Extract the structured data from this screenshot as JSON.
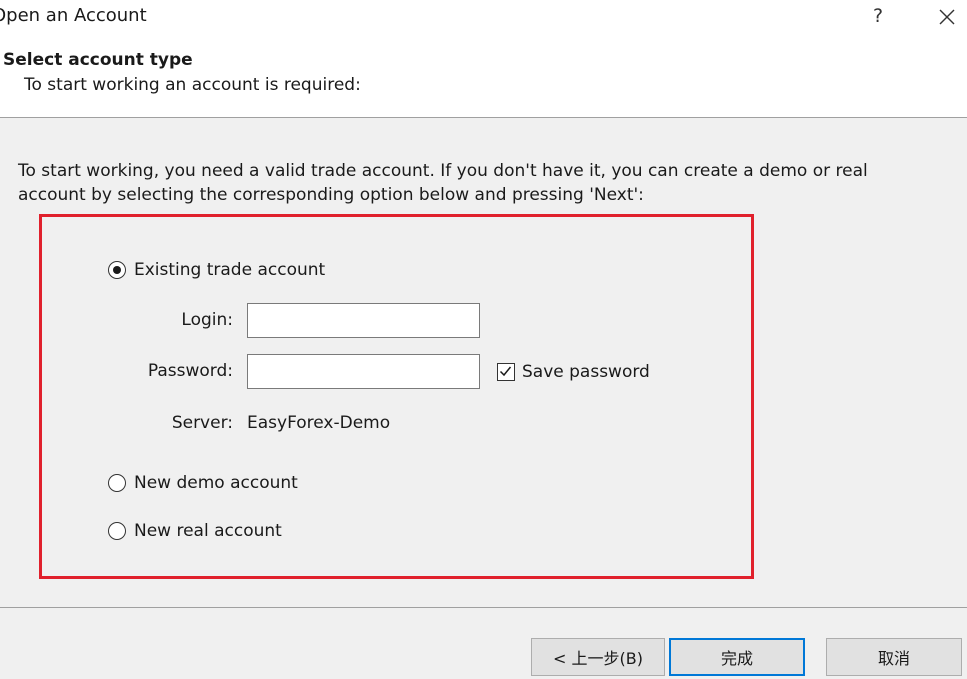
{
  "window": {
    "title": "Open an Account",
    "help_label": "?"
  },
  "header": {
    "heading": "Select account type",
    "subheading": "To start working an account is required:"
  },
  "intro_text": "To start working, you need a valid trade account. If you don't have it, you can create a demo or real account by selecting the corresponding option below and pressing 'Next':",
  "highlight_color": "#e0202c",
  "options": {
    "existing": {
      "label": "Existing trade account",
      "selected": true
    },
    "demo": {
      "label": "New demo account",
      "selected": false
    },
    "real": {
      "label": "New real account",
      "selected": false
    }
  },
  "form": {
    "login_label": "Login:",
    "login_value": "",
    "password_label": "Password:",
    "password_value": "",
    "save_password_label": "Save password",
    "save_password_checked": true,
    "server_label": "Server:",
    "server_value": "EasyForex-Demo"
  },
  "buttons": {
    "back": "< 上一步(B)",
    "finish": "完成",
    "cancel": "取消"
  },
  "icons": {
    "close": "close-icon",
    "check": "checkmark-icon"
  }
}
